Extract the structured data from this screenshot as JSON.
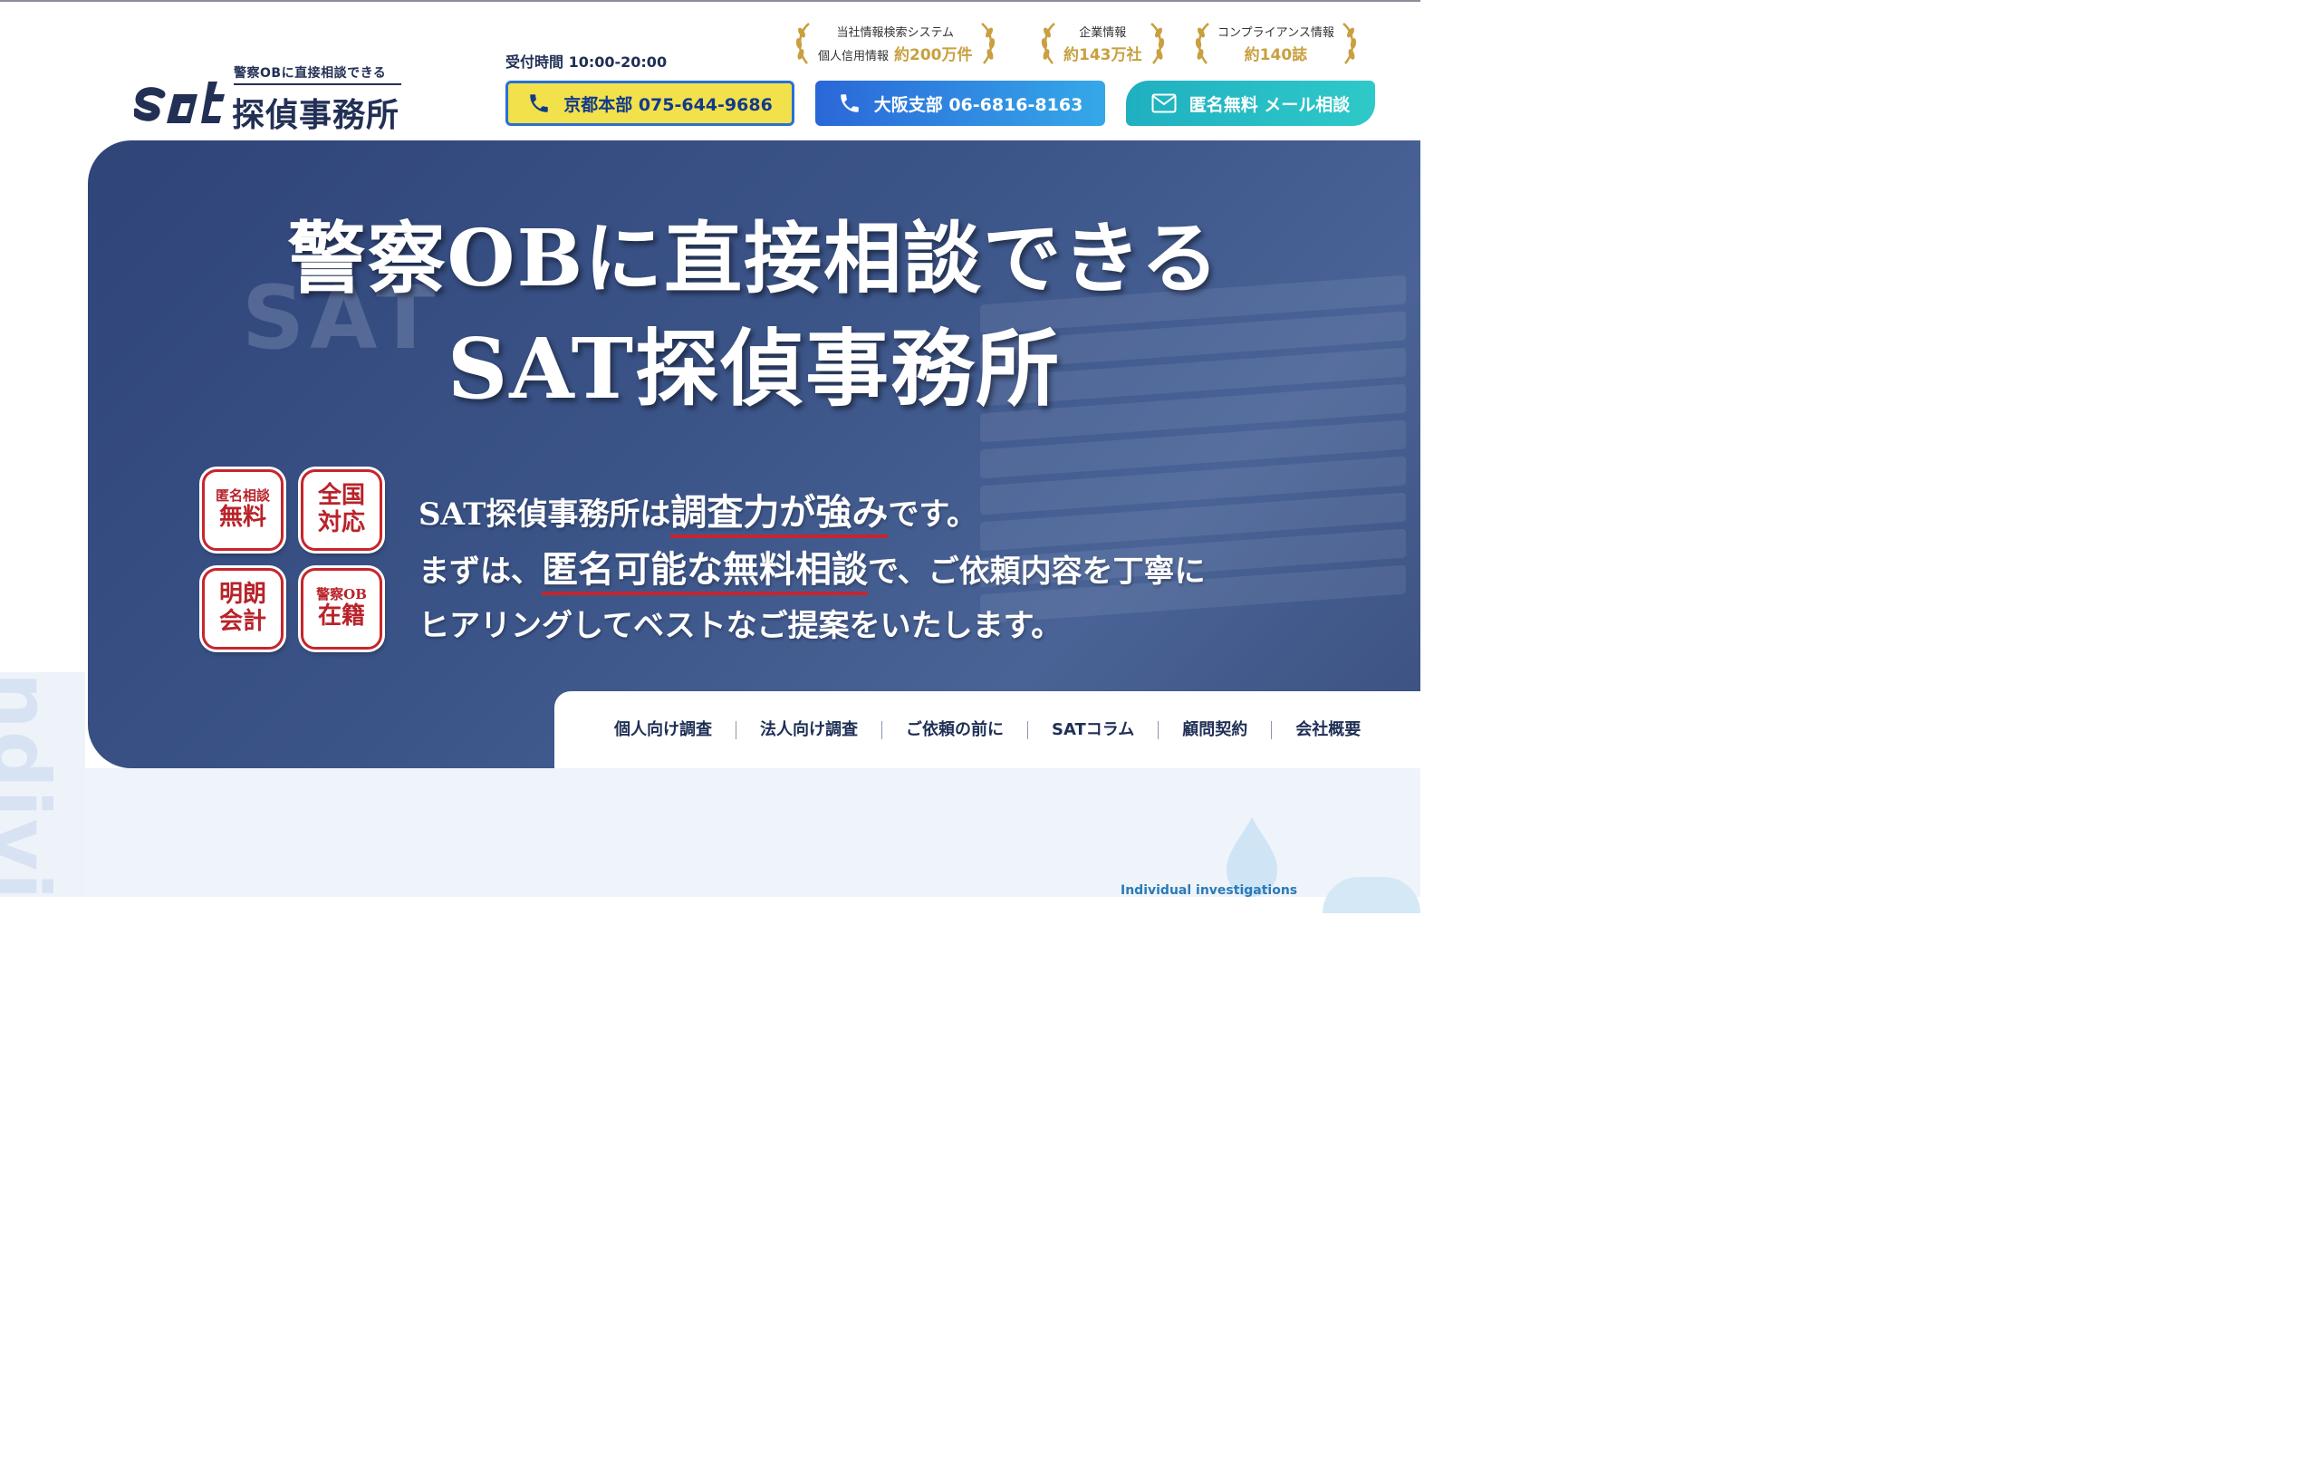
{
  "header": {
    "logo_tagline": "警察OBに直接相談できる",
    "logo_mark": "sat",
    "logo_name": "探偵事務所",
    "hours": "受付時間 10:00-20:00",
    "buttons": {
      "kyoto": "京都本部 075-644-9686",
      "osaka": "大阪支部 06-6816-8163",
      "mail": "匿名無料 メール相談"
    },
    "awards": [
      {
        "label": "当社情報検索システム",
        "prefix": "個人信用情報",
        "value": "約200万件"
      },
      {
        "label": "企業情報",
        "prefix": "",
        "value": "約143万社"
      },
      {
        "label": "コンプライアンス情報",
        "prefix": "",
        "value": "約140誌"
      }
    ]
  },
  "hero": {
    "title_line1": "警察OBに直接相談できる",
    "title_line2": "SAT探偵事務所",
    "badges": [
      {
        "top": "匿名相談",
        "bottom": "無料"
      },
      {
        "top": "全国",
        "bottom": "対応"
      },
      {
        "top": "明朗",
        "bottom": "会計"
      },
      {
        "top": "警察OB",
        "bottom": "在籍"
      }
    ],
    "lead": {
      "line1_pre": "SAT探偵事務所は",
      "line1_hl": "調査力が強み",
      "line1_post": "です。",
      "line2_pre": "まずは、",
      "line2_hl": "匿名可能な無料相談",
      "line2_post": "で、ご依頼内容を丁寧に",
      "line3": "ヒアリングしてベストなご提案をいたします。"
    }
  },
  "nav": {
    "items": [
      "個人向け調査",
      "法人向け調査",
      "ご依頼の前に",
      "SATコラム",
      "顧問契約",
      "会社概要"
    ]
  },
  "lower": {
    "side_word": "ndivi",
    "section_en": "Individual investigations"
  },
  "colors": {
    "navy": "#233055",
    "gold": "#c8a040",
    "red": "#c7252d",
    "blue_btn": "#2a67d8",
    "teal_btn": "#1fb0c0",
    "yellow_btn": "#f2e14a"
  }
}
